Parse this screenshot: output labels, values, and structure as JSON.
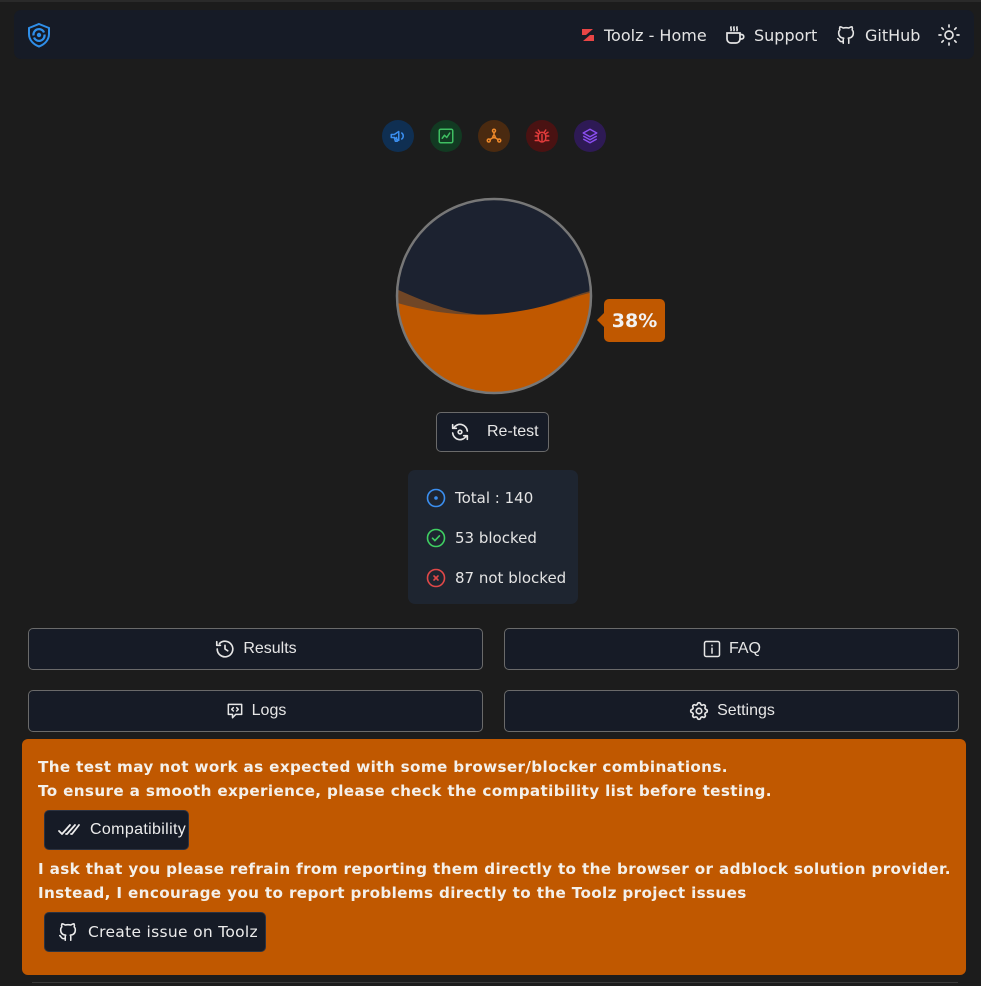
{
  "header": {
    "links": {
      "toolz_home": "Toolz - Home",
      "support": "Support",
      "github": "GitHub"
    }
  },
  "categories": [
    {
      "name": "ads",
      "icon": "megaphone-icon",
      "color": "#3b8ff0",
      "bg": "#0f2f52"
    },
    {
      "name": "analytics",
      "icon": "chart-line-icon",
      "color": "#3fbf62",
      "bg": "#123a22"
    },
    {
      "name": "trackers",
      "icon": "network-icon",
      "color": "#f08a2a",
      "bg": "#4a2a10"
    },
    {
      "name": "error-monitors",
      "icon": "bug-icon",
      "color": "#e03b3b",
      "bg": "#4a1212"
    },
    {
      "name": "other",
      "icon": "layers-icon",
      "color": "#8a4ef0",
      "bg": "#2e1a55"
    }
  ],
  "gauge": {
    "percent_label": "38%",
    "percent_value": 38,
    "fill_color": "#c05800"
  },
  "retest_label": "Re-test",
  "stats": {
    "total": "Total : 140",
    "blocked": "53 blocked",
    "not_blocked": "87 not blocked"
  },
  "actions": {
    "results": "Results",
    "faq": "FAQ",
    "logs": "Logs",
    "settings": "Settings"
  },
  "alert": {
    "line1": "The test may not work as expected with some browser/blocker combinations.",
    "line2": "To ensure a smooth experience, please check the compatibility list before testing.",
    "compat_button": "Compatibility",
    "line3": "I ask that you please refrain from reporting them directly to the browser or adblock solution provider.",
    "line4": "Instead, I encourage you to report problems directly to the Toolz project issues",
    "issue_button": "Create issue on Toolz"
  }
}
